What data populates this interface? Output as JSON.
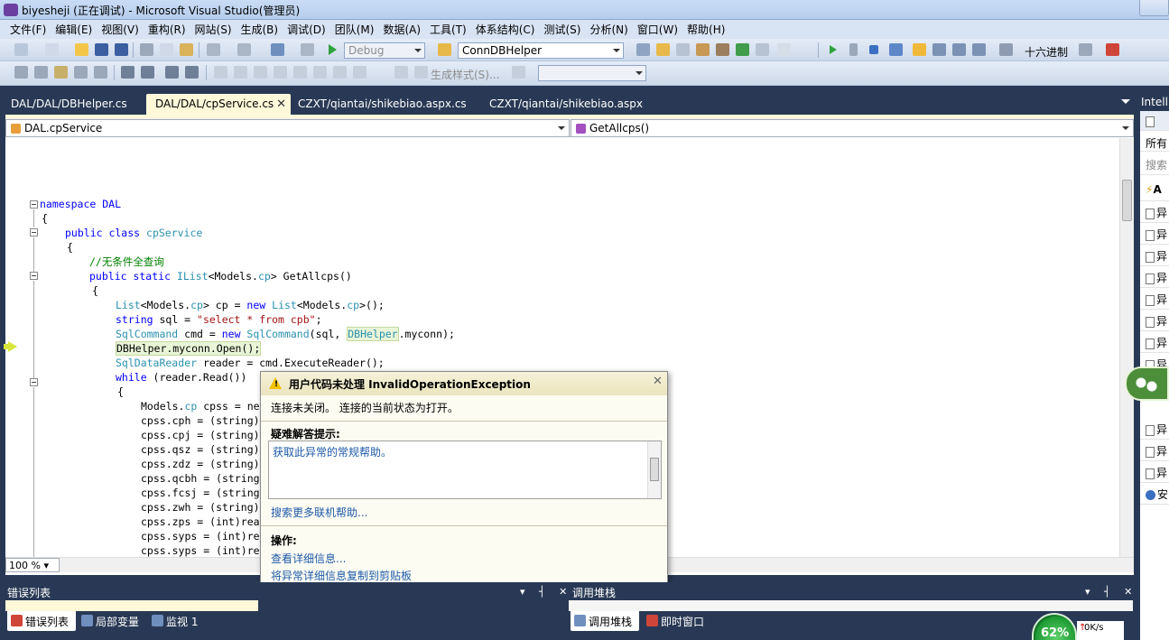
{
  "window": {
    "title": "biyesheji (正在调试) - Microsoft Visual Studio(管理员)"
  },
  "menu": [
    "文件(F)",
    "编辑(E)",
    "视图(V)",
    "重构(R)",
    "网站(S)",
    "生成(B)",
    "调试(D)",
    "团队(M)",
    "数据(A)",
    "工具(T)",
    "体系结构(C)",
    "测试(S)",
    "分析(N)",
    "窗口(W)",
    "帮助(H)"
  ],
  "toolbar": {
    "config": "Debug",
    "find_target": "ConnDBHelper",
    "hex_label": "十六进制",
    "build_style": "生成样式(S)..."
  },
  "tabs": [
    {
      "label": "DAL/DAL/DBHelper.cs"
    },
    {
      "label": "DAL/DAL/cpService.cs"
    },
    {
      "label": "CZXT/qiantai/shikebiao.aspx.cs"
    },
    {
      "label": "CZXT/qiantai/shikebiao.aspx"
    }
  ],
  "navbar": {
    "type": "DAL.cpService",
    "member": "GetAllcps()"
  },
  "code": {
    "l1": "namespace DAL",
    "l2": "{",
    "l3_kw": "public class ",
    "l3_type": "cpService",
    "l4": "{",
    "l5": "//无条件全查询",
    "l6_kw": "public static ",
    "l6_type": "IList",
    "l6_rest": "<Models.",
    "l6_type2": "cp",
    "l6_end": "> GetAllcps()",
    "l7": "{",
    "l8": "List<Models.cp> cp = new List<Models.cp>();",
    "l9_kw": "string ",
    "l9_a": "sql = ",
    "l9_str": "\"select * from cpb\"",
    "l9_end": ";",
    "l10_type": "SqlCommand ",
    "l10_a": "cmd = ",
    "l10_kw": "new ",
    "l10_type2": "SqlCommand",
    "l10_b": "(sql, ",
    "l10_type3": "DBHelper",
    "l10_end": ".myconn);",
    "l11": "DBHelper.myconn.Open();",
    "l12_type": "SqlDataReader ",
    "l12_a": "reader = cmd.ExecuteReader();",
    "l13_kw": "while ",
    "l13_a": "(reader.Read())",
    "l14": "{",
    "l15_a": "Models.",
    "l15_type": "cp ",
    "l15_b": "cpss = ne",
    "l16": "cpss.cph = (string)",
    "l17": "cpss.cpj = (string)",
    "l18": "cpss.qsz = (string)",
    "l19": "cpss.zdz = (string)",
    "l20": "cpss.qcbh = (string",
    "l21": "cpss.fcsj = (string",
    "l22": "cpss.zwh = (string)",
    "l23": "cpss.zps = (int)rea",
    "l24": "cpss.syps = (int)re",
    "l25": "cpss.syps = (int)re"
  },
  "zoom": "100 %",
  "exception": {
    "title": "用户代码未处理 InvalidOperationException",
    "message": "连接未关闭。 连接的当前状态为打开。",
    "hints_label": "疑难解答提示:",
    "hint_link": "获取此异常的常规帮助。",
    "more_help": "搜索更多联机帮助...",
    "actions_label": "操作:",
    "action_details": "查看详细信息...",
    "action_copy": "将异常详细信息复制到剪贴板"
  },
  "panes": {
    "errors_title": "错误列表",
    "callstack_title": "调用堆栈",
    "bottom_tabs_left": [
      "错误列表",
      "局部变量",
      "监视 1"
    ],
    "bottom_tabs_right": [
      "调用堆栈",
      "即时窗口"
    ]
  },
  "right_pane": {
    "title": "Intelli",
    "header": "所有",
    "search": "搜索",
    "first_item": "A",
    "items": [
      "异",
      "异",
      "异",
      "异",
      "异",
      "异",
      "异",
      "异",
      "异",
      "异",
      "异"
    ],
    "last_item": "安"
  },
  "net_meter": {
    "percent": "62%",
    "speed": "0K/s"
  }
}
